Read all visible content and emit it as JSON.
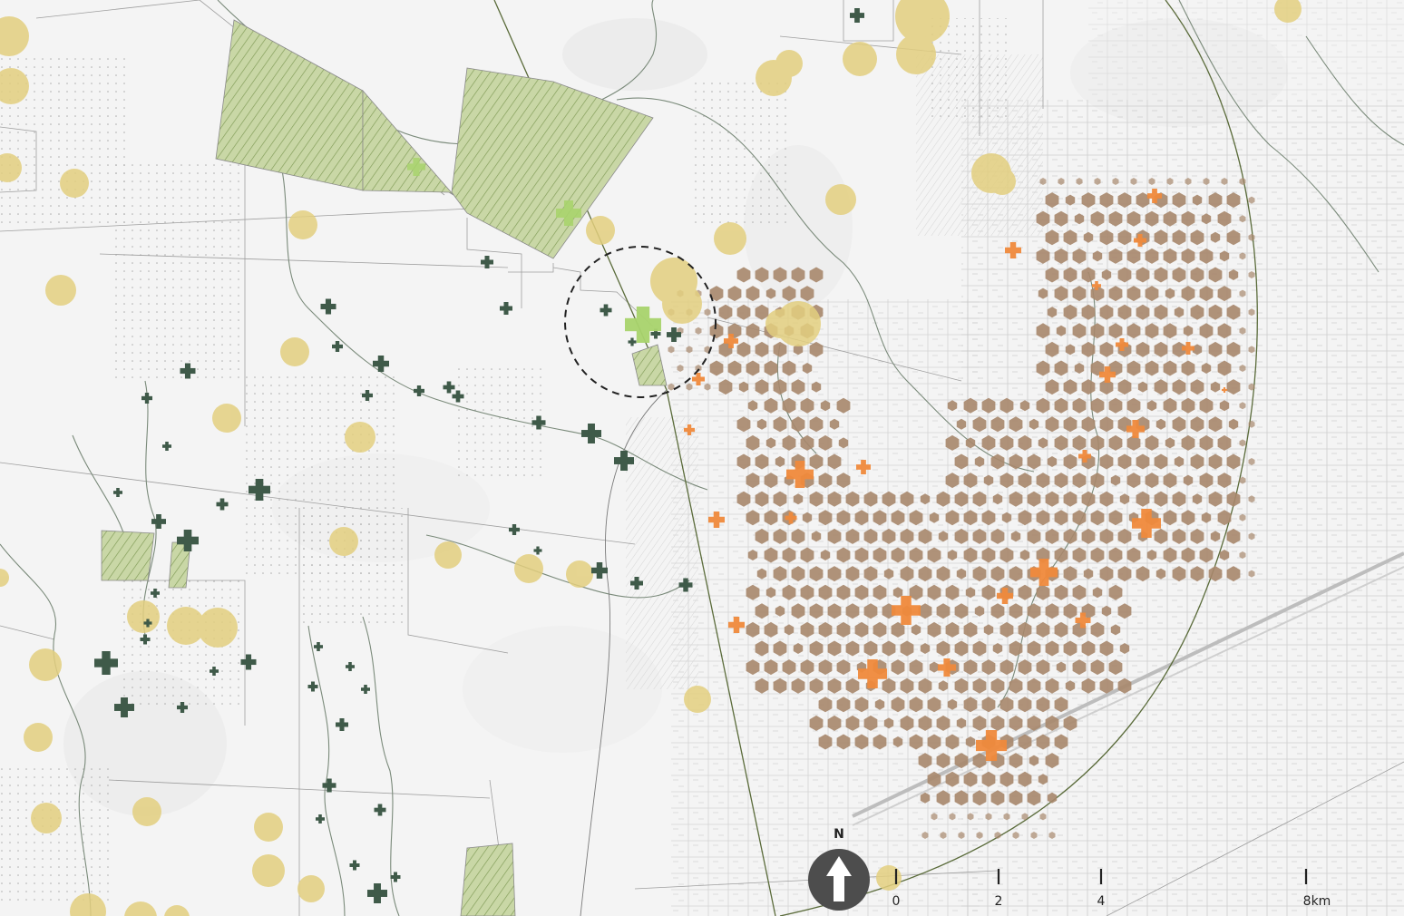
{
  "map": {
    "north_label": "N",
    "scale_bar": {
      "unit": "km",
      "tick_labels": [
        "0",
        "2",
        "4",
        "8km"
      ]
    }
  },
  "legend_colors": {
    "background": "#f4f4f4",
    "reserve_fill": "#c9d7a6",
    "reserve_hatch": "#7f9a55",
    "reserve_edge": "#8a8a8a",
    "yellow_circle": "#e3cf7f",
    "hexagon": "#a7876c",
    "orange_cross": "#f08a3c",
    "green_cross": "#3f5a49",
    "lightgreen_cross": "#a9d46d",
    "ring_line": "#5a6b3a",
    "road_line": "#9e9e9e",
    "creek_line": "#7a8a7a",
    "dashed_circle": "#222222"
  },
  "icons": {
    "north_arrow": "north-arrow-icon",
    "green_marker": "green-plus-icon",
    "orange_marker": "orange-plus-icon"
  }
}
